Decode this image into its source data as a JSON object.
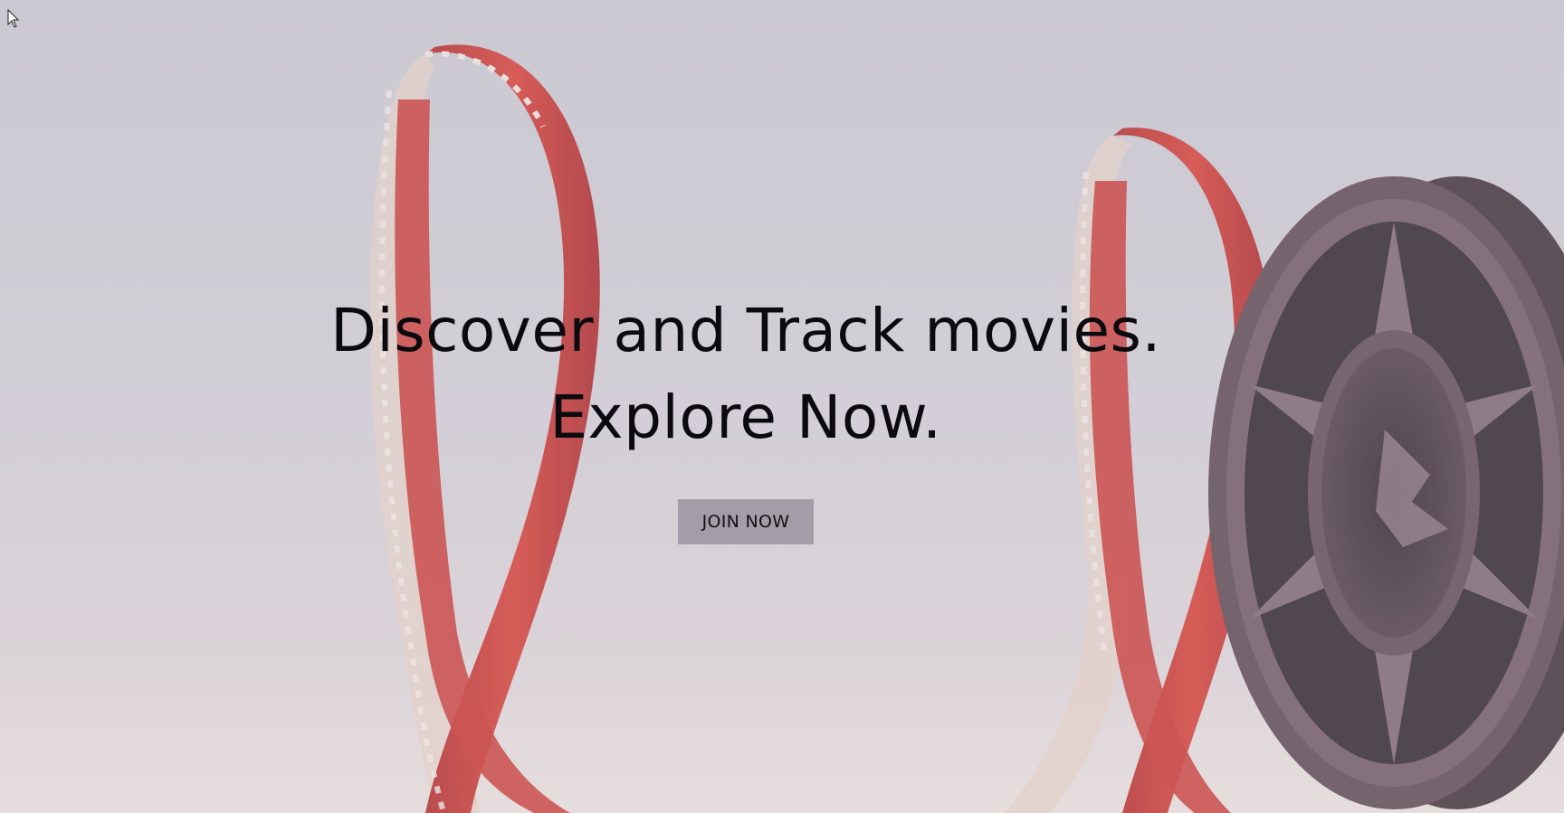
{
  "hero": {
    "headline_line1": "Discover and Track movies.",
    "headline_line2": "Explore Now.",
    "cta_label": "JOIN NOW"
  },
  "background": {
    "image_subject": "film-reel-icon",
    "colors": {
      "backdrop": "#cfcbd3",
      "film_red": "#c42a26",
      "reel_dark": "#3a2a34",
      "button_bg": "#a49ca8"
    }
  },
  "cursor": {
    "icon": "arrow-cursor-icon"
  }
}
